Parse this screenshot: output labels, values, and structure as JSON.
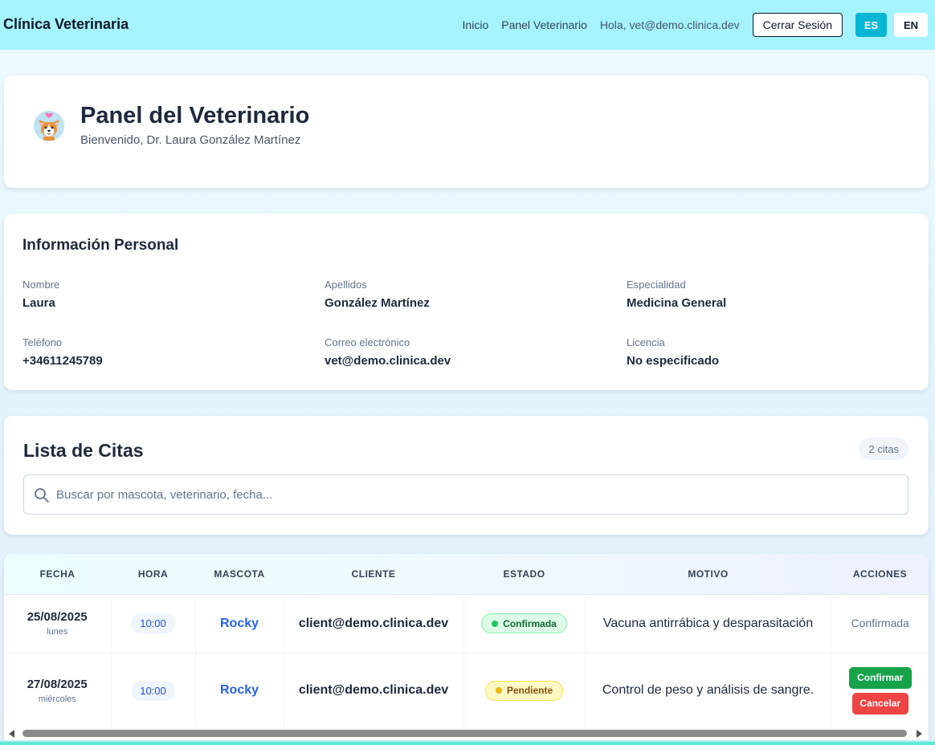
{
  "navbar": {
    "brand": "Clínica Veterinaria",
    "links": [
      "Inicio",
      "Panel Veterinario"
    ],
    "greeting": "Hola, vet@demo.clinica.dev",
    "logout_label": "Cerrar Sesión",
    "lang_es": "ES",
    "lang_en": "EN",
    "active_lang": "ES"
  },
  "header": {
    "logo_icon": "corgi-dog-icon",
    "title": "Panel del Veterinario",
    "subtitle": "Bienvenido, Dr. Laura González Martínez"
  },
  "personal_info": {
    "title": "Información Personal",
    "fields": [
      {
        "label": "Nombre",
        "value": "Laura"
      },
      {
        "label": "Apellidos",
        "value": "González Martínez"
      },
      {
        "label": "Especialidad",
        "value": "Medicina General"
      },
      {
        "label": "Teléfono",
        "value": "+34611245789"
      },
      {
        "label": "Correo electrónico",
        "value": "vet@demo.clinica.dev"
      },
      {
        "label": "Licencia",
        "value": "No especificado"
      }
    ]
  },
  "appointments": {
    "title": "Lista de Citas",
    "count_label": "2 citas",
    "search_placeholder": "Buscar por mascota, veterinario, fecha...",
    "columns": [
      "FECHA",
      "HORA",
      "MASCOTA",
      "CLIENTE",
      "ESTADO",
      "MOTIVO",
      "ACCIONES"
    ],
    "rows": [
      {
        "date": "25/08/2025",
        "weekday": "lunes",
        "time": "10:00",
        "pet": "Rocky",
        "client": "client@demo.clinica.dev",
        "status": "Confirmada",
        "reason": "Vacuna antirrábica y desparasitación",
        "action_text": "Confirmada"
      },
      {
        "date": "27/08/2025",
        "weekday": "miércoles",
        "time": "10:00",
        "pet": "Rocky",
        "client": "client@demo.clinica.dev",
        "status": "Pendiente",
        "reason": "Control de peso y análisis de sangre.",
        "confirm_label": "Confirmar",
        "cancel_label": "Cancelar"
      }
    ]
  },
  "colors": {
    "navbar_bg": "#a5f3fc",
    "accent": "#06b6d4",
    "confirm": "#16a34a",
    "cancel": "#ef4444",
    "link": "#2563eb"
  }
}
